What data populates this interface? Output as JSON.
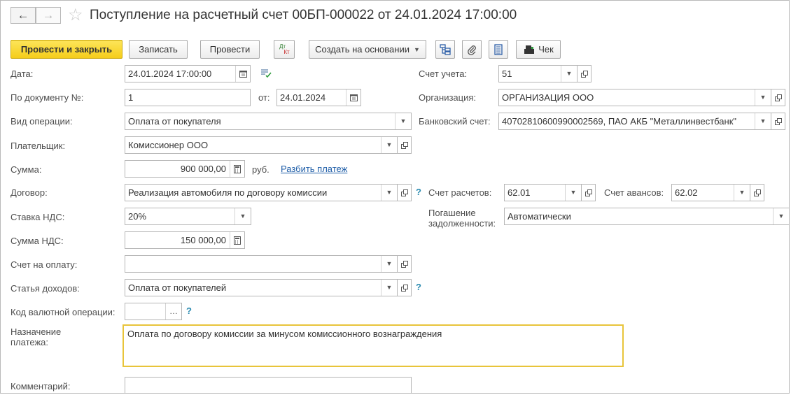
{
  "window": {
    "title": "Поступление на расчетный счет 00БП-000022 от 24.01.2024 17:00:00",
    "back_icon": "←",
    "forward_icon": "→",
    "star_icon": "☆"
  },
  "toolbar": {
    "post_close": "Провести и закрыть",
    "save": "Записать",
    "post": "Провести",
    "dt_top": "Дт",
    "dt_bottom": "Кт",
    "create_based": "Создать на основании",
    "check": "Чек"
  },
  "form": {
    "date": {
      "label": "Дата:",
      "value": "24.01.2024 17:00:00"
    },
    "doc_number": {
      "label": "По документу №:",
      "value": "1"
    },
    "doc_date": {
      "label": "от:",
      "value": "24.01.2024"
    },
    "operation": {
      "label": "Вид операции:",
      "value": "Оплата от покупателя"
    },
    "payer": {
      "label": "Плательщик:",
      "value": "Комиссионер ООО"
    },
    "amount": {
      "label": "Сумма:",
      "value": "900 000,00",
      "currency": "руб.",
      "split_link": "Разбить платеж"
    },
    "contract": {
      "label": "Договор:",
      "value": "Реализация автомобиля по договору комиссии",
      "help": "?"
    },
    "vat_rate": {
      "label": "Ставка НДС:",
      "value": "20%"
    },
    "vat_amount": {
      "label": "Сумма НДС:",
      "value": "150 000,00"
    },
    "invoice": {
      "label": "Счет на оплату:",
      "value": ""
    },
    "income_item": {
      "label": "Статья доходов:",
      "value": "Оплата от покупателей",
      "help": "?"
    },
    "currency_code": {
      "label": "Код валютной операции:",
      "value": "",
      "help": "?"
    },
    "purpose": {
      "label_1": "Назначение",
      "label_2": "платежа:",
      "value": "Оплата по договору комиссии за минусом комиссионного вознаграждения"
    },
    "comment": {
      "label": "Комментарий:",
      "value": ""
    },
    "account": {
      "label": "Счет учета:",
      "value": "51"
    },
    "organization": {
      "label": "Организация:",
      "value": "ОРГАНИЗАЦИЯ ООО"
    },
    "bank_account": {
      "label": "Банковский счет:",
      "value": "40702810600990002569, ПАО АКБ \"Металлинвестбанк\""
    },
    "settlement_account": {
      "label": "Счет расчетов:",
      "value": "62.01"
    },
    "advance_account": {
      "label": "Счет авансов:",
      "value": "62.02"
    },
    "debt_repayment": {
      "label_1": "Погашение",
      "label_2": "задолженности:",
      "value": "Автоматически"
    }
  },
  "colors": {
    "primary_button": "#f5cd1a",
    "link": "#1f5ea8",
    "help": "#2a8ab0",
    "focus_border": "#e8c43a"
  }
}
